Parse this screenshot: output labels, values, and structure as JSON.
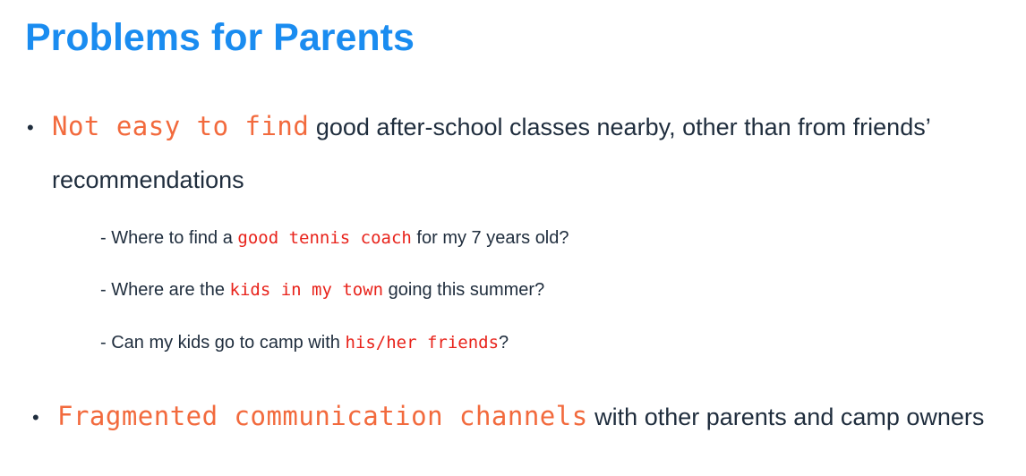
{
  "slide": {
    "title": "Problems for Parents",
    "bullets": [
      {
        "highlight": "Not easy to find",
        "text_line1": " good after-school classes nearby, other than from friends’",
        "text_line2": "recommendations",
        "sub_items": [
          {
            "prefix": "- Where to find a ",
            "highlight": "good tennis coach",
            "suffix": " for my 7 years old?"
          },
          {
            "prefix": "- Where are the ",
            "highlight": "kids in my town",
            "suffix": " going this summer?"
          },
          {
            "prefix": "- Can my kids go to camp with ",
            "highlight": "his/her friends",
            "suffix": "?"
          }
        ]
      },
      {
        "highlight": "Fragmented communication channels",
        "text": " with other parents and camp owners"
      }
    ],
    "bullet_symbol": "•",
    "colors": {
      "title": "#1a8cf0",
      "highlight_main": "#f26a3d",
      "highlight_sub": "#e8231b",
      "body_text": "#1f2d3d"
    }
  }
}
